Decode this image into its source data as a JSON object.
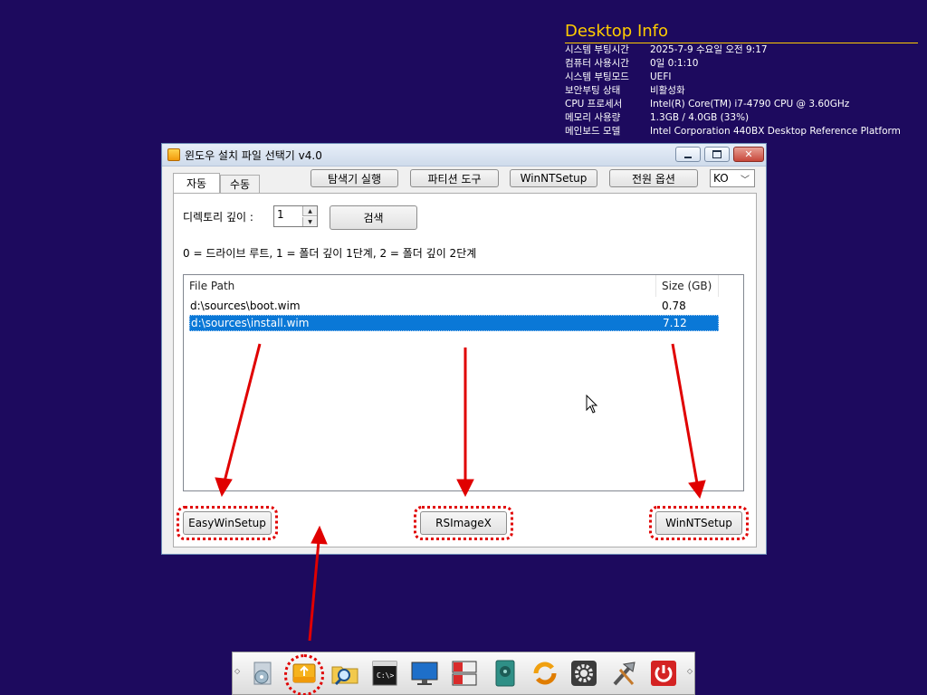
{
  "desktop_info": {
    "title": "Desktop Info",
    "rows": [
      {
        "key": "시스템 부팅시간",
        "value": "2025-7-9 수요일 오전 9:17"
      },
      {
        "key": "컴퓨터 사용시간",
        "value": "0일 0:1:10"
      },
      {
        "key": "시스템 부팅모드",
        "value": "UEFI"
      },
      {
        "key": "보안부팅 상태",
        "value": "비활성화"
      },
      {
        "key": "CPU 프로세서",
        "value": "Intel(R) Core(TM) i7-4790 CPU @ 3.60GHz"
      },
      {
        "key": "메모리 사용량",
        "value": "1.3GB / 4.0GB (33%)"
      },
      {
        "key": "메인보드 모델",
        "value": "Intel Corporation 440BX Desktop Reference Platform"
      }
    ]
  },
  "window": {
    "title": "윈도우 설치 파일 선택기 v4.0",
    "tabs": [
      "자동",
      "수동"
    ],
    "toolbar": {
      "explorer": "탐색기 실행",
      "partition": "파티션 도구",
      "winntsetup": "WinNTSetup",
      "power": "전원 옵션",
      "language": "KO"
    },
    "depth_label": "디렉토리 깊이 :",
    "depth_value": "1",
    "search_button": "검색",
    "hint": "0 = 드라이브 루트, 1 = 폴더 깊이 1단계, 2 = 폴더 깊이 2단계",
    "list": {
      "headers": [
        "File Path",
        "Size (GB)"
      ],
      "rows": [
        {
          "path": "d:\\sources\\boot.wim",
          "size": "0.78"
        },
        {
          "path": "d:\\sources\\install.wim",
          "size": "7.12",
          "selected": true
        }
      ]
    },
    "bottom_buttons": {
      "easy": "EasyWinSetup",
      "rsimagex": "RSImageX",
      "winnt": "WinNTSetup"
    }
  },
  "taskbar": {
    "icons": [
      "media-icon",
      "usb-installer-icon",
      "folder-search-icon",
      "command-prompt-icon",
      "monitor-icon",
      "storage-panel-icon",
      "disk-icon",
      "sync-icon",
      "settings-gear-icon",
      "tools-icon",
      "power-icon"
    ]
  },
  "colors": {
    "desktop_bg": "#1d0a5e",
    "info_title": "#ffcc00",
    "selection": "#0a78d7",
    "annotation_red": "#e00000"
  }
}
